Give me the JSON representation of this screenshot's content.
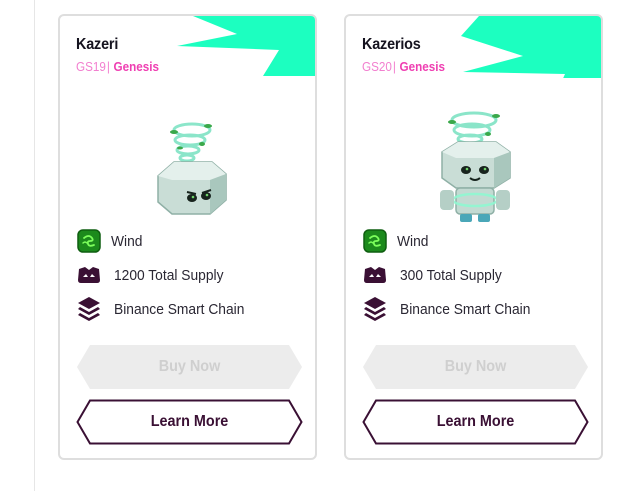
{
  "colors": {
    "accent_corner": "#1cffc0",
    "edition_pink": "#ef3fb2",
    "button_border": "#3a1034",
    "disabled_fill": "#ececec"
  },
  "cards": [
    {
      "name": "Kazeri",
      "code": "GS19",
      "separator": "|",
      "edition": "Genesis",
      "art_icon": "tornado-box-creature",
      "element_icon": "wind-element-icon",
      "element": "Wind",
      "supply_icon": "supply-icon",
      "supply": "1200 Total Supply",
      "chain_icon": "layers-chain-icon",
      "chain": "Binance Smart Chain",
      "buy_label": "Buy Now",
      "learn_label": "Learn More"
    },
    {
      "name": "Kazerios",
      "code": "GS20",
      "separator": "|",
      "edition": "Genesis",
      "art_icon": "tornado-cube-robot",
      "element_icon": "wind-element-icon",
      "element": "Wind",
      "supply_icon": "supply-icon",
      "supply": "300 Total Supply",
      "chain_icon": "layers-chain-icon",
      "chain": "Binance Smart Chain",
      "buy_label": "Buy Now",
      "learn_label": "Learn More"
    }
  ]
}
